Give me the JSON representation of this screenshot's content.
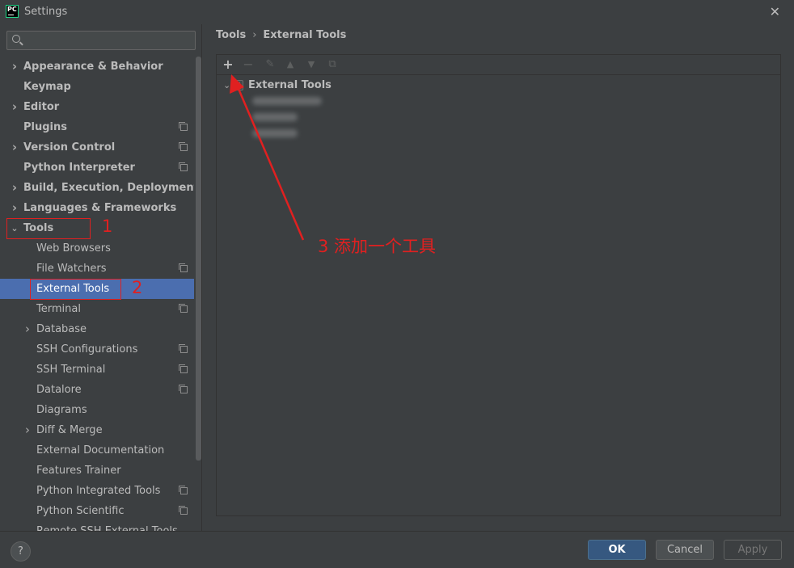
{
  "window": {
    "title": "Settings",
    "app_icon_text": "PC"
  },
  "search": {
    "value": "",
    "placeholder": ""
  },
  "sidebar": {
    "items": [
      {
        "label": "Appearance & Behavior",
        "level": 0,
        "expandable": true,
        "bold": true,
        "copy": false
      },
      {
        "label": "Keymap",
        "level": 0,
        "expandable": false,
        "bold": true,
        "copy": false
      },
      {
        "label": "Editor",
        "level": 0,
        "expandable": true,
        "bold": true,
        "copy": false
      },
      {
        "label": "Plugins",
        "level": 0,
        "expandable": false,
        "bold": true,
        "copy": true
      },
      {
        "label": "Version Control",
        "level": 0,
        "expandable": true,
        "bold": true,
        "copy": true
      },
      {
        "label": "Python Interpreter",
        "level": 0,
        "expandable": false,
        "bold": true,
        "copy": true
      },
      {
        "label": "Build, Execution, Deployment",
        "level": 0,
        "expandable": true,
        "bold": true,
        "copy": false
      },
      {
        "label": "Languages & Frameworks",
        "level": 0,
        "expandable": true,
        "bold": true,
        "copy": false
      },
      {
        "label": "Tools",
        "level": 0,
        "expandable": true,
        "expanded": true,
        "bold": true,
        "copy": false
      },
      {
        "label": "Web Browsers",
        "level": 1,
        "expandable": false,
        "copy": false
      },
      {
        "label": "File Watchers",
        "level": 1,
        "expandable": false,
        "copy": true
      },
      {
        "label": "External Tools",
        "level": 1,
        "expandable": false,
        "copy": false,
        "selected": true
      },
      {
        "label": "Terminal",
        "level": 1,
        "expandable": false,
        "copy": true
      },
      {
        "label": "Database",
        "level": 1,
        "expandable": true,
        "copy": false
      },
      {
        "label": "SSH Configurations",
        "level": 1,
        "expandable": false,
        "copy": true
      },
      {
        "label": "SSH Terminal",
        "level": 1,
        "expandable": false,
        "copy": true
      },
      {
        "label": "Datalore",
        "level": 1,
        "expandable": false,
        "copy": true
      },
      {
        "label": "Diagrams",
        "level": 1,
        "expandable": false,
        "copy": false
      },
      {
        "label": "Diff & Merge",
        "level": 1,
        "expandable": true,
        "copy": false
      },
      {
        "label": "External Documentation",
        "level": 1,
        "expandable": false,
        "copy": false
      },
      {
        "label": "Features Trainer",
        "level": 1,
        "expandable": false,
        "copy": false
      },
      {
        "label": "Python Integrated Tools",
        "level": 1,
        "expandable": false,
        "copy": true
      },
      {
        "label": "Python Scientific",
        "level": 1,
        "expandable": false,
        "copy": true
      },
      {
        "label": "Remote SSH External Tools",
        "level": 1,
        "expandable": false,
        "copy": false
      }
    ]
  },
  "breadcrumb": {
    "parent": "Tools",
    "separator": "›",
    "current": "External Tools"
  },
  "toolbar": {
    "add": "+",
    "remove": "−",
    "edit": "✎",
    "up": "▲",
    "down": "▼",
    "copy": "⧉"
  },
  "panel": {
    "group_label": "External Tools",
    "group_checked": true
  },
  "annotations": {
    "one": "1",
    "two": "2",
    "three": "3 添加一个工具"
  },
  "buttons": {
    "help": "?",
    "ok": "OK",
    "cancel": "Cancel",
    "apply": "Apply"
  },
  "colors": {
    "accent": "#4b6eaf",
    "annotation": "#e02020",
    "ok_button": "#365880"
  }
}
